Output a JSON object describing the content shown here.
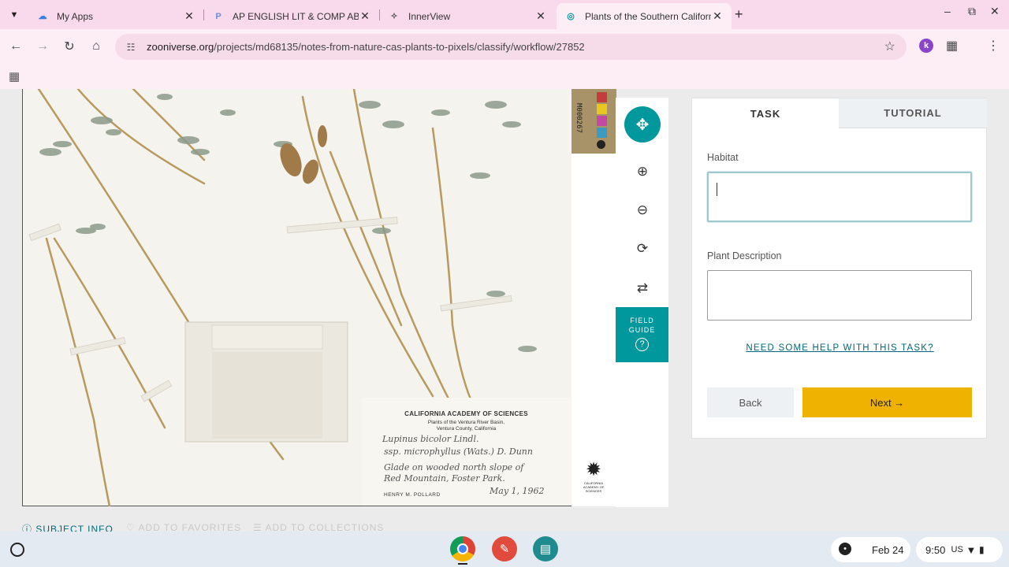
{
  "browser": {
    "tabs": [
      {
        "title": "My Apps",
        "active": false
      },
      {
        "title": "AP ENGLISH LIT & COMP ABC",
        "active": false
      },
      {
        "title": "InnerView",
        "active": false
      },
      {
        "title": "Plants of the Southern Californ",
        "active": true
      }
    ],
    "url_domain": "zooniverse.org",
    "url_path": "/projects/md68135/notes-from-nature-cas-plants-to-pixels/classify/workflow/27852",
    "extension_badge": "k"
  },
  "specimen": {
    "barcode": "M000267",
    "label": {
      "institution": "CALIFORNIA ACADEMY OF SCIENCES",
      "line1": "Plants of the Ventura River Basin,",
      "line2": "Ventura County, California",
      "species": "Lupinus bicolor Lindl.",
      "subspecies": "ssp. microphyllus (Wats.) D. Dunn",
      "habitat1": "Glade on wooded north slope of",
      "habitat2": "Red Mountain, Foster Park.",
      "collector": "HENRY M. POLLARD",
      "date": "May 1, 1962"
    },
    "logo_text": "CALIFORNIA ACADEMY OF SCIENCES"
  },
  "tools": {
    "field_guide_line1": "FIELD",
    "field_guide_line2": "GUIDE",
    "field_guide_icon": "?"
  },
  "task": {
    "tab_task": "TASK",
    "tab_tutorial": "TUTORIAL",
    "habitat_label": "Habitat",
    "habitat_value": "",
    "description_label": "Plant Description",
    "description_value": "",
    "help_link": "NEED SOME HELP WITH THIS TASK?",
    "back_label": "Back",
    "next_label": "Next →"
  },
  "subject_meta": {
    "info": "SUBJECT INFO",
    "favorites": "ADD TO FAVORITES",
    "collections": "ADD TO COLLECTIONS"
  },
  "shelf": {
    "date": "Feb 24",
    "time": "9:50",
    "locale": "US"
  },
  "colors": {
    "teal": "#00979d",
    "next_yellow": "#f0b200",
    "chrome_pink": "#f9d9ec"
  }
}
